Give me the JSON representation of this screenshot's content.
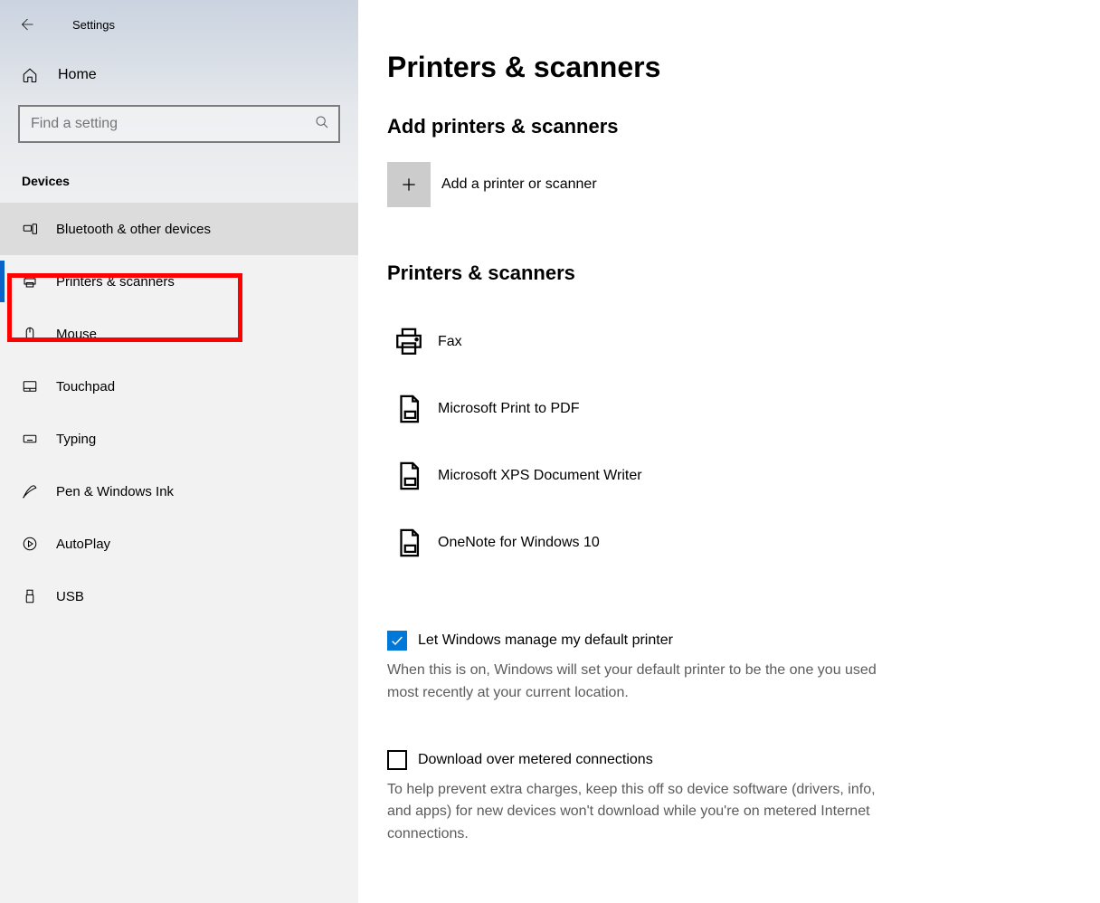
{
  "window": {
    "title": "Settings"
  },
  "sidebar": {
    "home": "Home",
    "search_placeholder": "Find a setting",
    "section": "Devices",
    "items": [
      {
        "label": "Bluetooth & other devices"
      },
      {
        "label": "Printers & scanners"
      },
      {
        "label": "Mouse"
      },
      {
        "label": "Touchpad"
      },
      {
        "label": "Typing"
      },
      {
        "label": "Pen & Windows Ink"
      },
      {
        "label": "AutoPlay"
      },
      {
        "label": "USB"
      }
    ]
  },
  "main": {
    "title": "Printers & scanners",
    "add_section_title": "Add printers & scanners",
    "add_button_label": "Add a printer or scanner",
    "list_section_title": "Printers & scanners",
    "devices": [
      {
        "label": "Fax"
      },
      {
        "label": "Microsoft Print to PDF"
      },
      {
        "label": "Microsoft XPS Document Writer"
      },
      {
        "label": "OneNote for Windows 10"
      }
    ],
    "default_printer": {
      "label": "Let Windows manage my default printer",
      "checked": true,
      "desc": "When this is on, Windows will set your default printer to be the one you used most recently at your current location."
    },
    "metered": {
      "label": "Download over metered connections",
      "checked": false,
      "desc": "To help prevent extra charges, keep this off so device software (drivers, info, and apps) for new devices won't download while you're on metered Internet connections."
    }
  }
}
